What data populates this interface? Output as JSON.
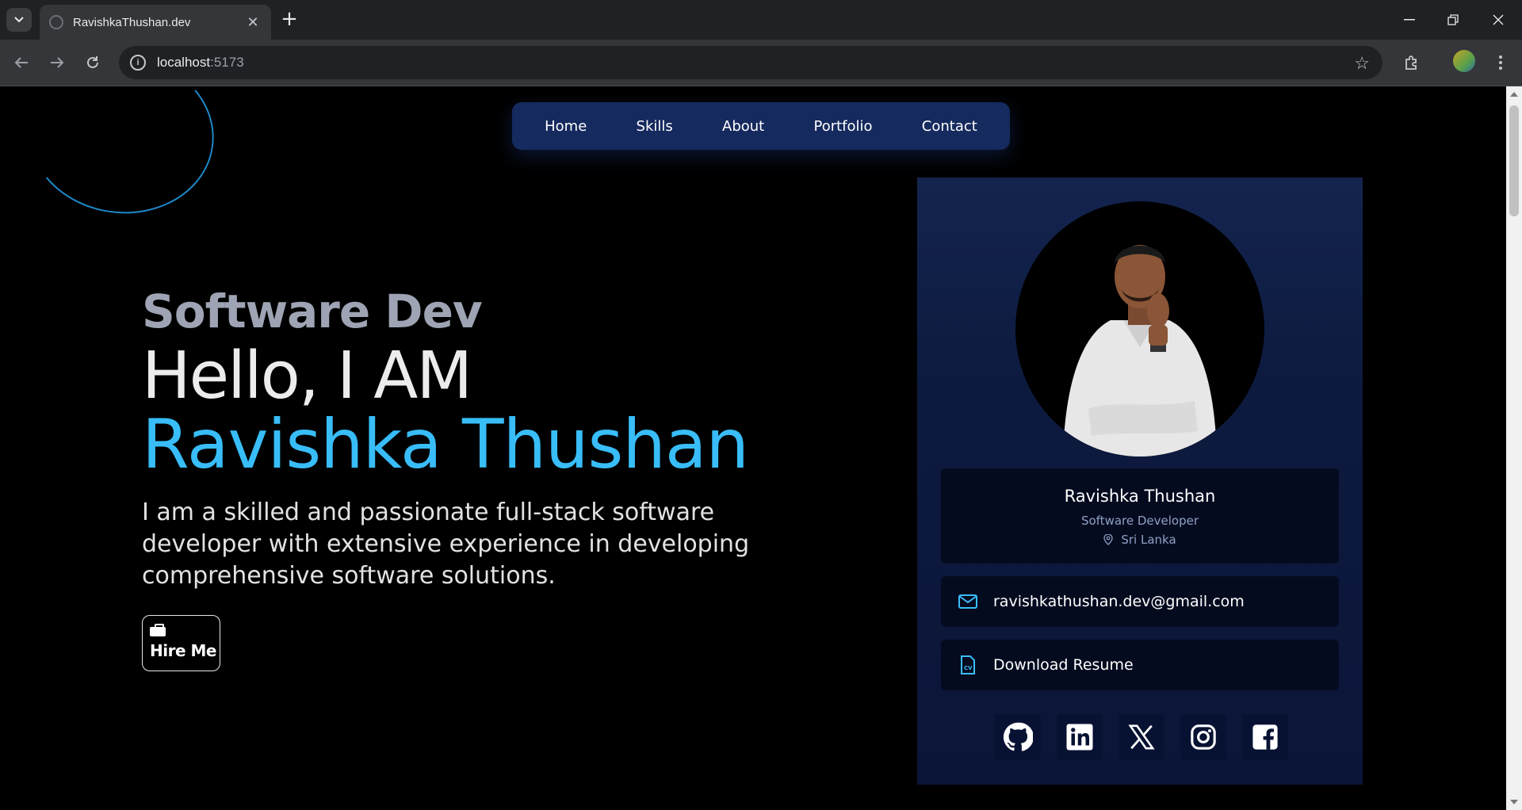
{
  "browser": {
    "tab_title": "RavishkaThushan.dev",
    "url_host": "localhost",
    "url_port": ":5173"
  },
  "nav": {
    "items": [
      "Home",
      "Skills",
      "About",
      "Portfolio",
      "Contact"
    ]
  },
  "hero": {
    "role": "Software Dev",
    "greeting": "Hello, I AM",
    "name": "Ravishka Thushan",
    "description": "I am a skilled and passionate full-stack software developer with extensive experience in developing comprehensive software solutions.",
    "hire_label": "Hire Me"
  },
  "profile_card": {
    "name": "Ravishka Thushan",
    "title": "Software Developer",
    "location": "Sri Lanka",
    "email": "ravishkathushan.dev@gmail.com",
    "resume_label": "Download Resume",
    "socials": [
      "github-icon",
      "linkedin-icon",
      "x-icon",
      "instagram-icon",
      "facebook-icon"
    ]
  },
  "colors": {
    "accent": "#38bdf8",
    "nav_bg": "#152a5e",
    "card_bg": "#0d1a3e"
  }
}
